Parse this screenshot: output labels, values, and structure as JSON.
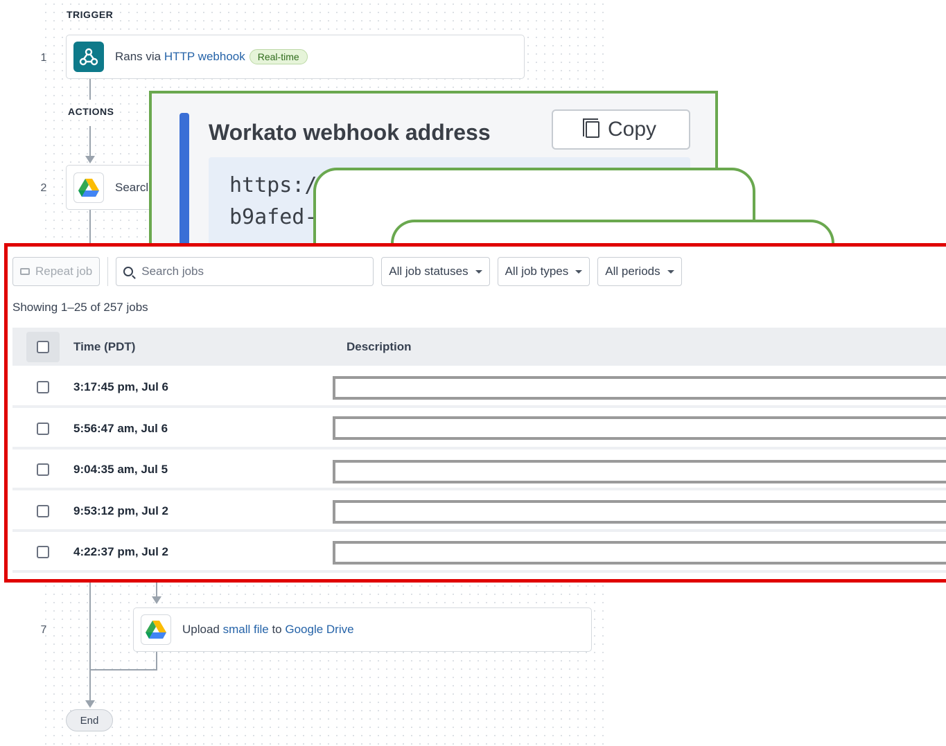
{
  "recipe": {
    "trigger_label": "TRIGGER",
    "actions_label": "ACTIONS",
    "steps": [
      {
        "num": "1",
        "prefix": "Rans via ",
        "link": "HTTP webhook",
        "badge": "Real-time"
      },
      {
        "num": "2",
        "text": "Searcl"
      },
      {
        "num": "7",
        "prefix": "Upload ",
        "link": "small file",
        "middle": " to ",
        "link2": "Google Drive"
      }
    ],
    "end_label": "End"
  },
  "webhook": {
    "title": "Workato webhook address",
    "copy_label": "Copy",
    "url_line1": "https://w",
    "url_line2": "b9afed-c"
  },
  "jobs": {
    "repeat_label": "Repeat job",
    "search_placeholder": "Search jobs",
    "filters": [
      "All job statuses",
      "All job types",
      "All periods"
    ],
    "count_text": "Showing 1–25 of 257 jobs",
    "columns": {
      "time": "Time (PDT)",
      "description": "Description"
    },
    "rows": [
      {
        "time": "3:17:45 pm, Jul 6"
      },
      {
        "time": "5:56:47 am, Jul 6"
      },
      {
        "time": "9:04:35 am, Jul 5"
      },
      {
        "time": "9:53:12 pm, Jul 2"
      },
      {
        "time": "4:22:37 pm, Jul 2"
      }
    ]
  },
  "colors": {
    "highlight_red": "#e00000",
    "highlight_green": "#6aa84f",
    "link": "#2563a8",
    "accent_blue": "#3a6fd6"
  },
  "icons": [
    "webhook-icon",
    "google-drive-icon",
    "copy-icon",
    "search-icon",
    "repeat-icon",
    "chevron-down-icon"
  ]
}
